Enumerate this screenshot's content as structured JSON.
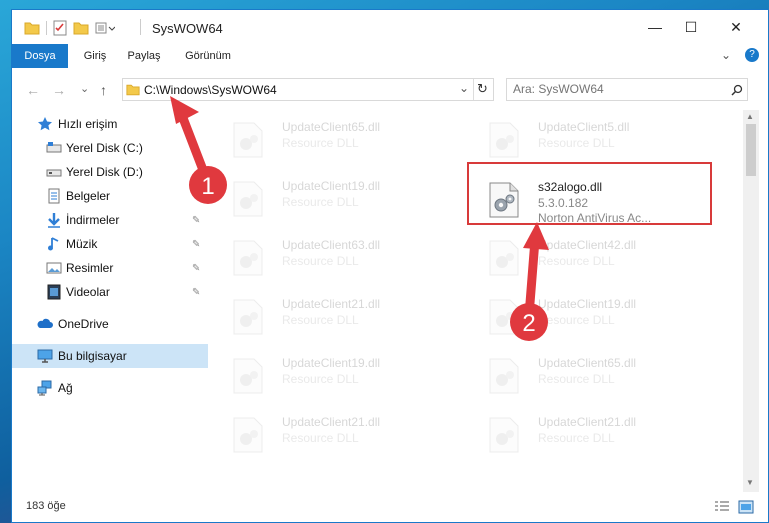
{
  "window": {
    "title": "SysWOW64",
    "controls": {
      "minimize": "—",
      "maximize": "☐",
      "close": "✕"
    }
  },
  "ribbon": {
    "tabs": [
      {
        "label": "Dosya",
        "active": true
      },
      {
        "label": "Giriş",
        "active": false
      },
      {
        "label": "Paylaş",
        "active": false
      },
      {
        "label": "Görünüm",
        "active": false
      }
    ],
    "expand_glyph": "⌄",
    "help_glyph": "?"
  },
  "address": {
    "path": "C:\\Windows\\SysWOW64",
    "dropdown_glyph": "⌄",
    "refresh_glyph": "↻"
  },
  "search": {
    "placeholder": "Ara: SysWOW64",
    "search_glyph": "⚲"
  },
  "nav_glyphs": {
    "back": "←",
    "forward": "→",
    "recent": "⌄",
    "up": "↑"
  },
  "sidebar": {
    "items": [
      {
        "label": "Hızlı erişim",
        "icon": "star-icon",
        "pinned": false
      },
      {
        "label": "Yerel Disk (C:)",
        "icon": "drive-icon",
        "pinned": false
      },
      {
        "label": "Yerel Disk (D:)",
        "icon": "drive-icon",
        "pinned": false
      },
      {
        "label": "Belgeler",
        "icon": "documents-icon",
        "pinned": true
      },
      {
        "label": "İndirmeler",
        "icon": "download-icon",
        "pinned": true
      },
      {
        "label": "Müzik",
        "icon": "music-icon",
        "pinned": true
      },
      {
        "label": "Resimler",
        "icon": "pictures-icon",
        "pinned": true
      },
      {
        "label": "Videolar",
        "icon": "videos-icon",
        "pinned": true
      },
      {
        "label": "OneDrive",
        "icon": "cloud-icon",
        "pinned": false
      },
      {
        "label": "Bu bilgisayar",
        "icon": "computer-icon",
        "pinned": false,
        "selected": true
      },
      {
        "label": "Ağ",
        "icon": "network-icon",
        "pinned": false
      }
    ],
    "pin_glyph": "📌"
  },
  "files": {
    "left_column": [
      {
        "name": "UpdateClient65.dll",
        "sub": "Resource DLL"
      },
      {
        "name": "UpdateClient19.dll",
        "sub": "Resource DLL"
      },
      {
        "name": "UpdateClient63.dll",
        "sub": "Resource DLL"
      },
      {
        "name": "UpdateClient21.dll",
        "sub": "Resource DLL"
      },
      {
        "name": "UpdateClient19.dll",
        "sub": "Resource DLL"
      },
      {
        "name": "UpdateClient21.dll",
        "sub": "Resource DLL"
      }
    ],
    "right_column": [
      {
        "name": "UpdateClient5.dll",
        "sub": "Resource DLL"
      },
      {
        "name": "UpdateClient42.dll",
        "sub": "Resource DLL"
      },
      {
        "name": "UpdateClient19.dll",
        "sub": "Resource DLL"
      },
      {
        "name": "UpdateClient65.dll",
        "sub": "Resource DLL"
      },
      {
        "name": "UpdateClient21.dll",
        "sub": "Resource DLL"
      }
    ],
    "highlighted": {
      "name": "s32alogo.dll",
      "version": "5.3.0.182",
      "description": "Norton AntiVirus Ac..."
    }
  },
  "annotations": {
    "step1": "1",
    "step2": "2",
    "color": "#e0393e"
  },
  "status": {
    "item_count": "183 öğe"
  }
}
